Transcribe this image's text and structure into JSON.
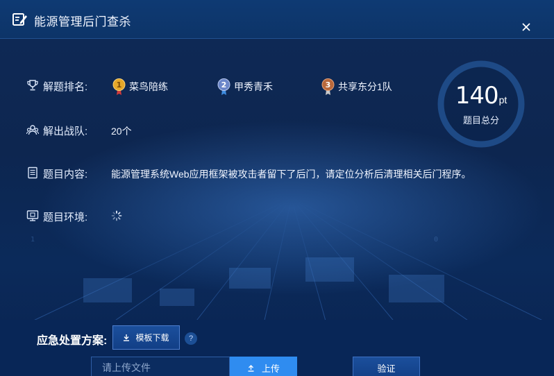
{
  "dialog": {
    "title": "能源管理后门查杀",
    "close_icon": "close-icon"
  },
  "info": {
    "ranking": {
      "label": "解题排名:",
      "icon": "trophy-icon",
      "items": [
        {
          "rank": "1",
          "name": "菜鸟陪练",
          "medal_color": "#e5a82a"
        },
        {
          "rank": "2",
          "name": "甲秀青禾",
          "medal_color": "#6b86c9"
        },
        {
          "rank": "3",
          "name": "共享东分1队",
          "medal_color": "#b9683b"
        }
      ]
    },
    "teams": {
      "label": "解出战队:",
      "icon": "team-icon",
      "value": "20个"
    },
    "content": {
      "label": "题目内容:",
      "icon": "document-icon",
      "value": "能源管理系统Web应用框架被攻击者留下了后门，请定位分析后清理相关后门程序。"
    },
    "environment": {
      "label": "题目环境:",
      "icon": "monitor-icon",
      "status_icon": "loading-spinner-icon"
    }
  },
  "score": {
    "value": "140",
    "unit": "pt",
    "caption": "题目总分"
  },
  "emergency": {
    "label": "应急处置方案:",
    "template_button": "模板下载",
    "help": "?",
    "upload_placeholder": "请上传文件",
    "upload_button": "上传",
    "verify_button": "验证"
  },
  "colors": {
    "accent": "#2f8cf0",
    "background": "#0d2650",
    "ring": "#1e4a86"
  }
}
